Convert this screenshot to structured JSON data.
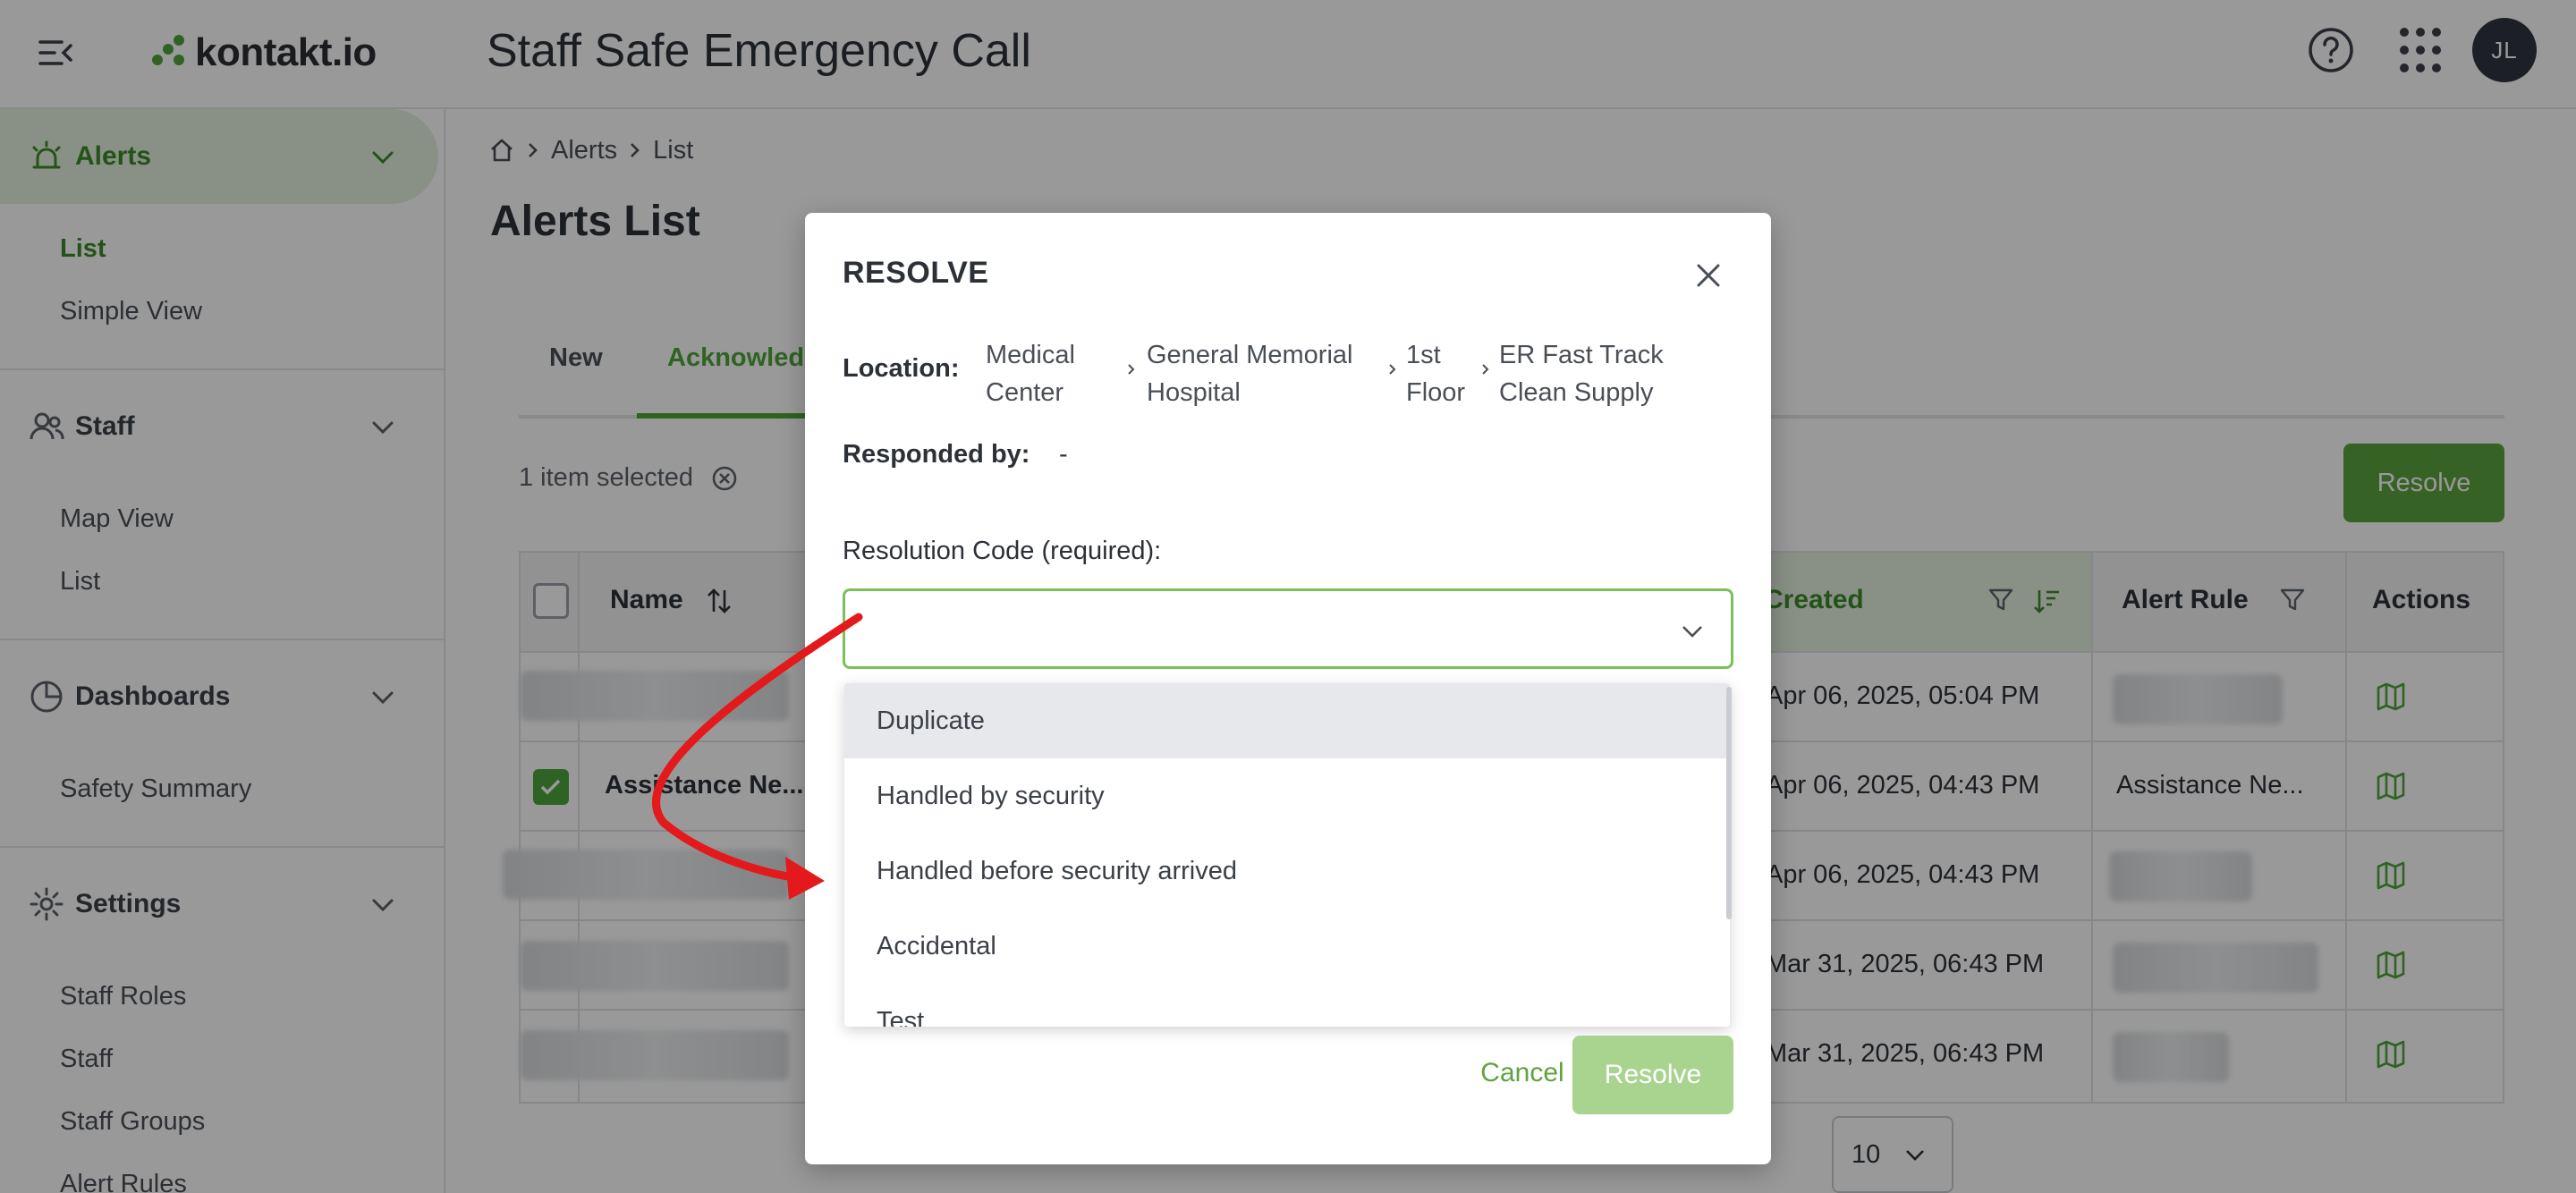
{
  "header": {
    "logo_text": "kontakt.io",
    "app_title": "Staff Safe Emergency Call",
    "avatar_initials": "JL"
  },
  "sidebar": {
    "groups": [
      {
        "label": "Alerts",
        "items": [
          "List",
          "Simple View"
        ]
      },
      {
        "label": "Staff",
        "items": [
          "Map View",
          "List"
        ]
      },
      {
        "label": "Dashboards",
        "items": [
          "Safety Summary"
        ]
      },
      {
        "label": "Settings",
        "items": [
          "Staff Roles",
          "Staff",
          "Staff Groups",
          "Alert Rules"
        ]
      }
    ]
  },
  "breadcrumb": [
    "Alerts",
    "List"
  ],
  "page_title": "Alerts List",
  "tabs": [
    "New",
    "Acknowled"
  ],
  "selection_text": "1 item selected",
  "resolve_label": "Resolve",
  "table": {
    "columns": {
      "name": "Name",
      "created": "Created",
      "alert_rule": "Alert Rule",
      "actions": "Actions"
    },
    "rows": [
      {
        "name": "",
        "created": "Apr 06, 2025, 05:04 PM",
        "alert_rule": ""
      },
      {
        "name": "Assistance Ne...",
        "created": "Apr 06, 2025, 04:43 PM",
        "alert_rule": "Assistance Ne..."
      },
      {
        "name": "",
        "created": "Apr 06, 2025, 04:43 PM",
        "alert_rule": ""
      },
      {
        "name": "",
        "created": "Mar 31, 2025, 06:43 PM",
        "alert_rule": ""
      },
      {
        "name": "",
        "created": "Mar 31, 2025, 06:43 PM",
        "alert_rule": ""
      }
    ]
  },
  "pager": {
    "page_size": "10"
  },
  "modal": {
    "title": "RESOLVE",
    "location_label": "Location:",
    "location": [
      {
        "line1": "Medical",
        "line2": "Center"
      },
      {
        "line1": "General Memorial",
        "line2": "Hospital"
      },
      {
        "line1": "1st",
        "line2": "Floor"
      },
      {
        "line1": "ER Fast Track",
        "line2": "Clean Supply"
      }
    ],
    "responded_label": "Responded by:",
    "responded_value": "-",
    "resolution_label": "Resolution Code (required):",
    "options": [
      "Duplicate",
      "Handled by security",
      "Handled before security arrived",
      "Accidental",
      "Test"
    ],
    "cancel_label": "Cancel",
    "resolve_label": "Resolve"
  },
  "colors": {
    "accent": "#4fa53b",
    "annotation_arrow": "#e3191c"
  }
}
